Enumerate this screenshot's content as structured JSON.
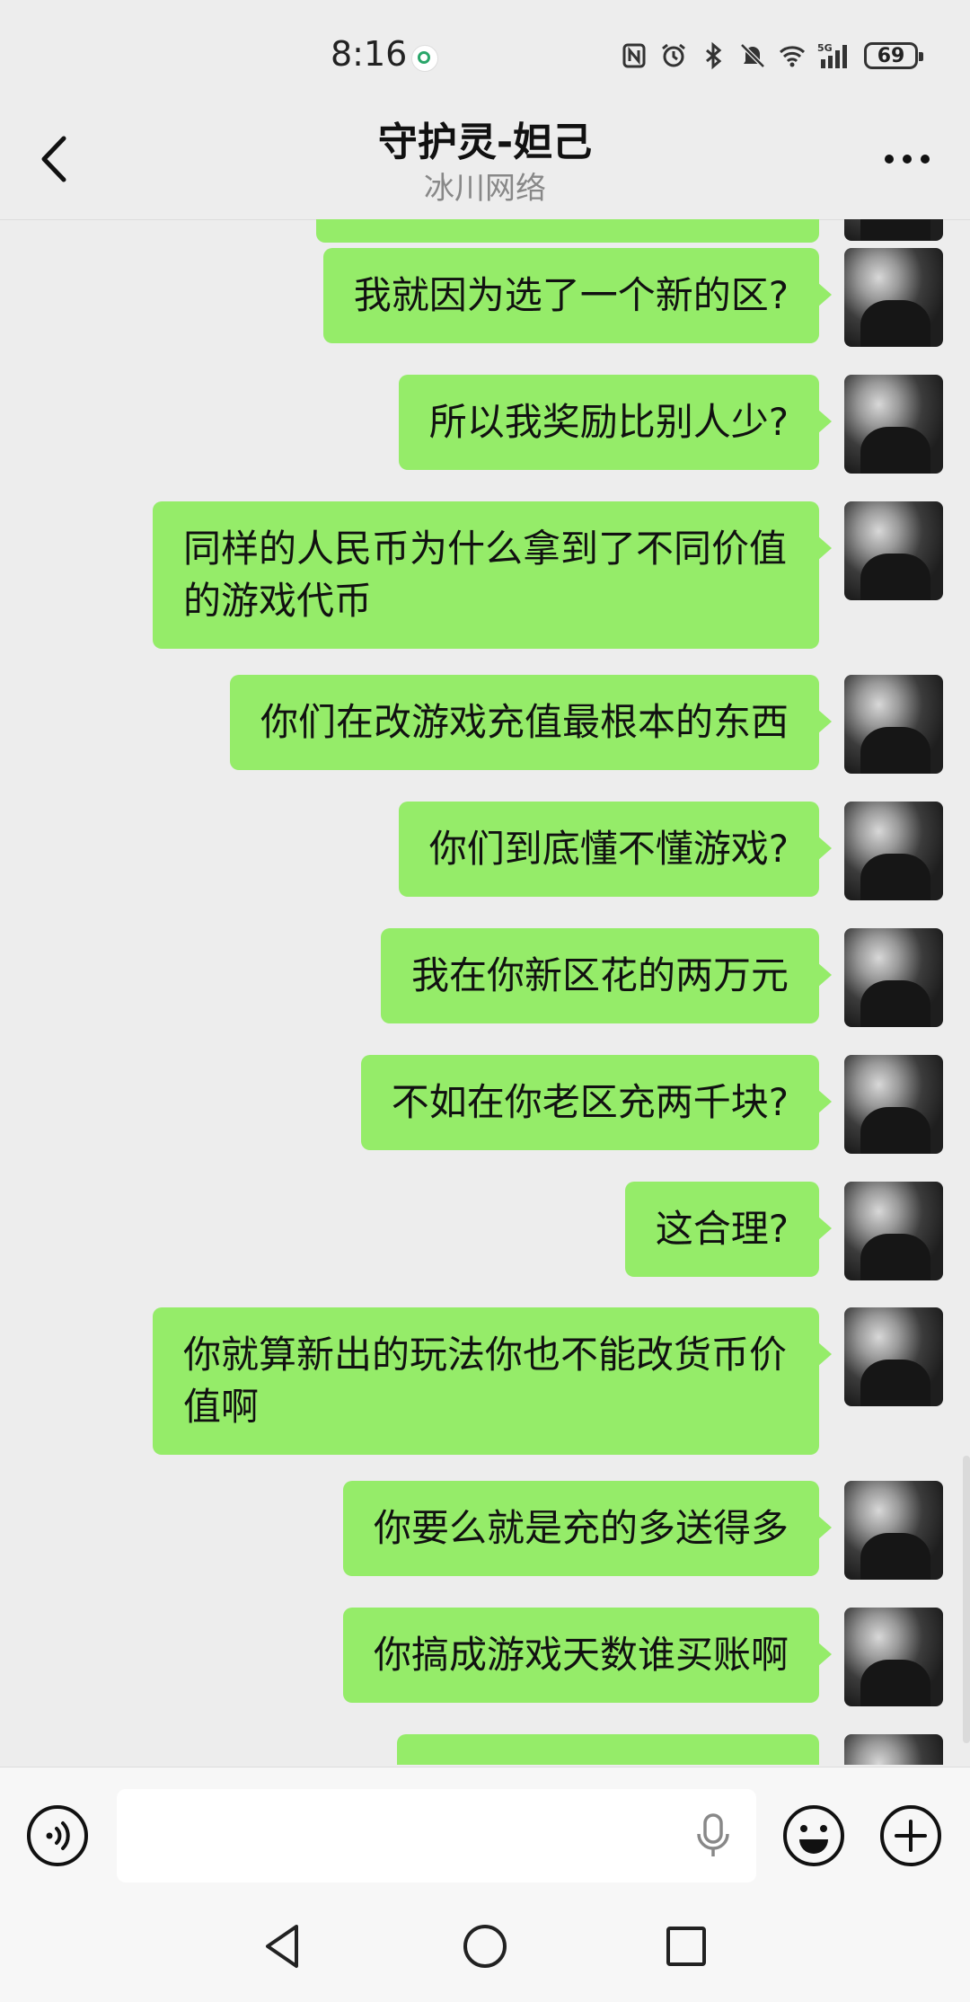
{
  "status_bar": {
    "time": "8:16",
    "network": "5G",
    "battery": "69"
  },
  "header": {
    "title": "守护灵-妲己",
    "subtitle": "冰川网络"
  },
  "messages": [
    {
      "text": "我就因为选了一个新的区?"
    },
    {
      "text": "所以我奖励比别人少?"
    },
    {
      "text": "同样的人民币为什么拿到了不同价值的游戏代币"
    },
    {
      "text": "你们在改游戏充值最根本的东西"
    },
    {
      "text": "你们到底懂不懂游戏?"
    },
    {
      "text": "我在你新区花的两万元"
    },
    {
      "text": "不如在你老区充两千块?"
    },
    {
      "text": "这合理?"
    },
    {
      "text": "你就算新出的玩法你也不能改货币价值啊"
    },
    {
      "text": "你要么就是充的多送得多"
    },
    {
      "text": "你搞成游戏天数谁买账啊"
    }
  ],
  "input": {
    "value": ""
  }
}
